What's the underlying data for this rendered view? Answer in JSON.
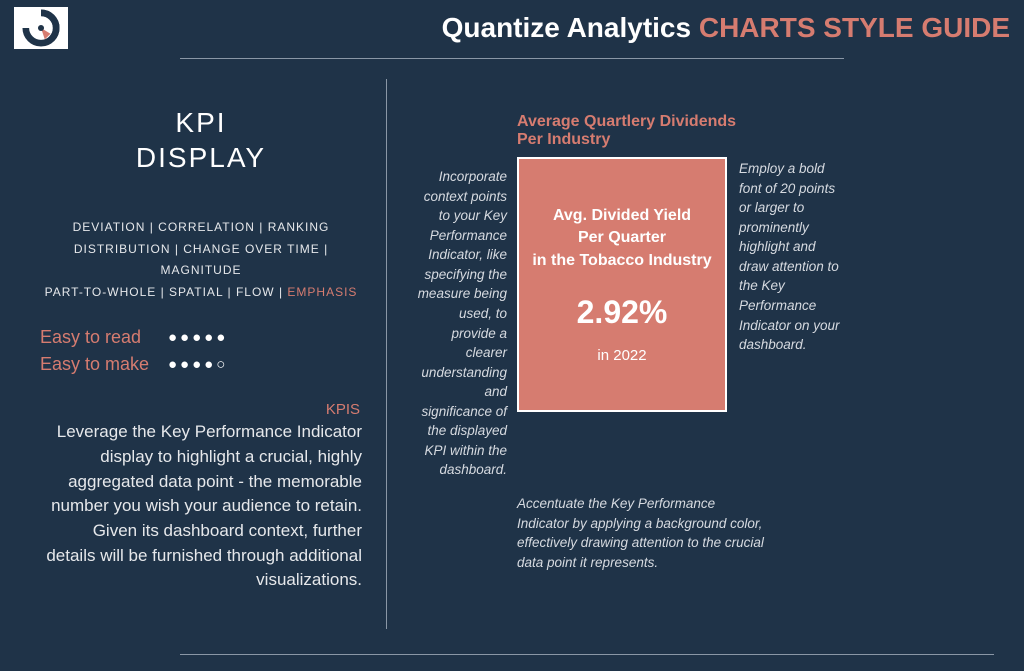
{
  "header": {
    "brand": "Quantize Analytics ",
    "subtitle": "CHARTS STYLE GUIDE"
  },
  "left": {
    "title": "KPI\nDISPLAY",
    "tags_line1": "DEVIATION | CORRELATION | RANKING",
    "tags_line2": "DISTRIBUTION | CHANGE OVER TIME | MAGNITUDE",
    "tags_line3_prefix": "PART-TO-WHOLE | SPATIAL | FLOW | ",
    "tags_line3_emph": "EMPHASIS",
    "rating_read_label": "Easy to read",
    "rating_make_label": "Easy to make",
    "kpis_heading": "KPIS",
    "body": "Leverage the Key Performance Indicator display to highlight a crucial, highly aggregated data point - the memorable number you wish your audience to retain. Given its dashboard context, further details will be furnished through additional visualizations."
  },
  "right": {
    "chart_title": "Average Quartlery Dividends Per Industry",
    "left_note": "Incorporate context points to your Key Performance Indicator, like specifying the measure being used, to provide a clearer understanding and significance of the displayed KPI within the dashboard.",
    "card_line1": "Avg. Divided Yield",
    "card_line2": "Per Quarter",
    "card_line3": "in the Tobacco Industry",
    "card_value": "2.92%",
    "card_year": "in 2022",
    "right_note": "Employ a bold font of 20 points or larger to prominently highlight and draw attention to the Key Performance Indicator on your dashboard.",
    "bottom_note": "Accentuate the Key Performance Indicator by applying a background color, effectively drawing attention to the crucial data point it represents."
  },
  "ratings": {
    "read": 5,
    "make": 4
  }
}
